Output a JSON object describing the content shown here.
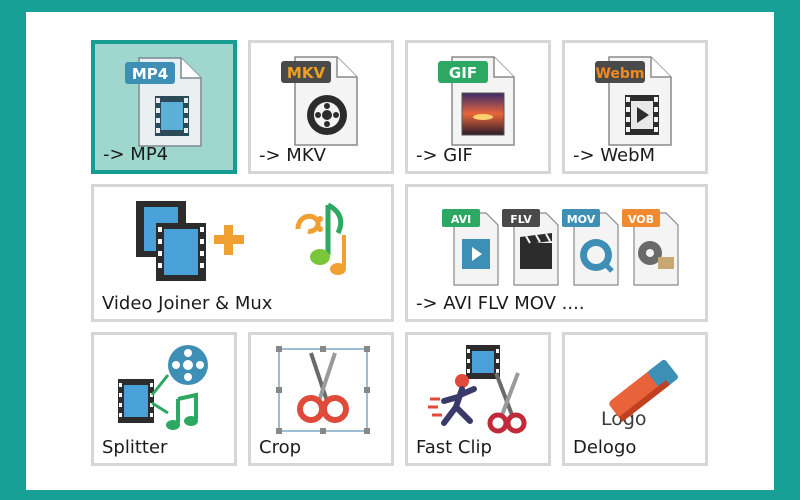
{
  "tiles": [
    {
      "id": "mp4",
      "label": "-> MP4",
      "badge": "MP4",
      "badge_color": "#3e8fb6",
      "selected": true
    },
    {
      "id": "mkv",
      "label": "-> MKV",
      "badge": "MKV",
      "badge_color": "#4a4a4a",
      "badge_text_color": "#f0a020"
    },
    {
      "id": "gif",
      "label": "-> GIF",
      "badge": "GIF",
      "badge_color": "#2ca862"
    },
    {
      "id": "webm",
      "label": "-> WebM",
      "badge": "Webm",
      "badge_color": "#4a4a4a",
      "badge_text_color": "#f08a20"
    },
    {
      "id": "joiner",
      "label": "Video Joiner & Mux"
    },
    {
      "id": "formats",
      "label": "-> AVI FLV MOV ....",
      "badges": [
        "AVI",
        "FLV",
        "MOV",
        "VOB"
      ],
      "badge_colors": [
        "#2ca862",
        "#4a4a4a",
        "#3e8fb6",
        "#f08a30"
      ]
    },
    {
      "id": "splitter",
      "label": "Splitter"
    },
    {
      "id": "crop",
      "label": "Crop"
    },
    {
      "id": "fastclip",
      "label": "Fast Clip"
    },
    {
      "id": "delogo",
      "label": "Delogo",
      "logo_text": "Logo"
    }
  ],
  "colors": {
    "frame": "#17a096",
    "tile_border": "#d6d6d6",
    "selected_fill": "#9fd7cf",
    "selected_border": "#169c90"
  }
}
